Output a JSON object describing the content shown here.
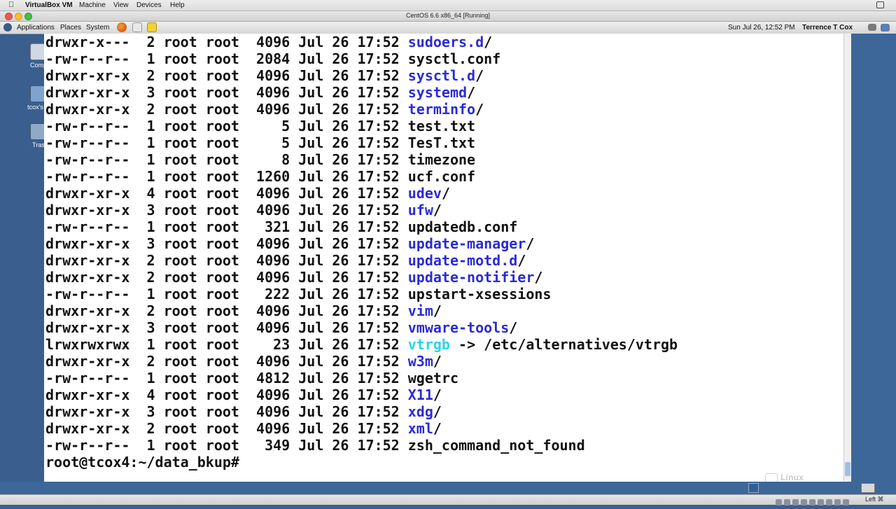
{
  "macbar": {
    "app": "VirtualBox VM",
    "menus": [
      "Machine",
      "View",
      "Devices",
      "Help"
    ]
  },
  "window": {
    "title": "CentOS 6.6 x86_64 [Running]"
  },
  "gnome_panel": {
    "menus": [
      "Applications",
      "Places",
      "System"
    ],
    "datetime": "Sun Jul 26, 12:52 PM",
    "user": "Terrence T Cox"
  },
  "desktop_icons": [
    {
      "label": "Comp",
      "icon": "computer-icon"
    },
    {
      "label": "tcox's H",
      "icon": "home-folder-icon"
    },
    {
      "label": "Tras",
      "icon": "trash-icon"
    }
  ],
  "terminal": {
    "entries": [
      {
        "perm": "drwxr-x---",
        "links": "2",
        "owner": "root",
        "group": "root",
        "size": "4096",
        "month": "Jul",
        "day": "26",
        "time": "17:52",
        "name": "sudoers.d",
        "suffix": "/",
        "type": "dir"
      },
      {
        "perm": "-rw-r--r--",
        "links": "1",
        "owner": "root",
        "group": "root",
        "size": "2084",
        "month": "Jul",
        "day": "26",
        "time": "17:52",
        "name": "sysctl.conf",
        "suffix": "",
        "type": "file"
      },
      {
        "perm": "drwxr-xr-x",
        "links": "2",
        "owner": "root",
        "group": "root",
        "size": "4096",
        "month": "Jul",
        "day": "26",
        "time": "17:52",
        "name": "sysctl.d",
        "suffix": "/",
        "type": "dir"
      },
      {
        "perm": "drwxr-xr-x",
        "links": "3",
        "owner": "root",
        "group": "root",
        "size": "4096",
        "month": "Jul",
        "day": "26",
        "time": "17:52",
        "name": "systemd",
        "suffix": "/",
        "type": "dir"
      },
      {
        "perm": "drwxr-xr-x",
        "links": "2",
        "owner": "root",
        "group": "root",
        "size": "4096",
        "month": "Jul",
        "day": "26",
        "time": "17:52",
        "name": "terminfo",
        "suffix": "/",
        "type": "dir"
      },
      {
        "perm": "-rw-r--r--",
        "links": "1",
        "owner": "root",
        "group": "root",
        "size": "5",
        "month": "Jul",
        "day": "26",
        "time": "17:52",
        "name": "test.txt",
        "suffix": "",
        "type": "file"
      },
      {
        "perm": "-rw-r--r--",
        "links": "1",
        "owner": "root",
        "group": "root",
        "size": "5",
        "month": "Jul",
        "day": "26",
        "time": "17:52",
        "name": "TesT.txt",
        "suffix": "",
        "type": "file"
      },
      {
        "perm": "-rw-r--r--",
        "links": "1",
        "owner": "root",
        "group": "root",
        "size": "8",
        "month": "Jul",
        "day": "26",
        "time": "17:52",
        "name": "timezone",
        "suffix": "",
        "type": "file"
      },
      {
        "perm": "-rw-r--r--",
        "links": "1",
        "owner": "root",
        "group": "root",
        "size": "1260",
        "month": "Jul",
        "day": "26",
        "time": "17:52",
        "name": "ucf.conf",
        "suffix": "",
        "type": "file"
      },
      {
        "perm": "drwxr-xr-x",
        "links": "4",
        "owner": "root",
        "group": "root",
        "size": "4096",
        "month": "Jul",
        "day": "26",
        "time": "17:52",
        "name": "udev",
        "suffix": "/",
        "type": "dir"
      },
      {
        "perm": "drwxr-xr-x",
        "links": "3",
        "owner": "root",
        "group": "root",
        "size": "4096",
        "month": "Jul",
        "day": "26",
        "time": "17:52",
        "name": "ufw",
        "suffix": "/",
        "type": "dir"
      },
      {
        "perm": "-rw-r--r--",
        "links": "1",
        "owner": "root",
        "group": "root",
        "size": "321",
        "month": "Jul",
        "day": "26",
        "time": "17:52",
        "name": "updatedb.conf",
        "suffix": "",
        "type": "file"
      },
      {
        "perm": "drwxr-xr-x",
        "links": "3",
        "owner": "root",
        "group": "root",
        "size": "4096",
        "month": "Jul",
        "day": "26",
        "time": "17:52",
        "name": "update-manager",
        "suffix": "/",
        "type": "dir"
      },
      {
        "perm": "drwxr-xr-x",
        "links": "2",
        "owner": "root",
        "group": "root",
        "size": "4096",
        "month": "Jul",
        "day": "26",
        "time": "17:52",
        "name": "update-motd.d",
        "suffix": "/",
        "type": "dir"
      },
      {
        "perm": "drwxr-xr-x",
        "links": "2",
        "owner": "root",
        "group": "root",
        "size": "4096",
        "month": "Jul",
        "day": "26",
        "time": "17:52",
        "name": "update-notifier",
        "suffix": "/",
        "type": "dir"
      },
      {
        "perm": "-rw-r--r--",
        "links": "1",
        "owner": "root",
        "group": "root",
        "size": "222",
        "month": "Jul",
        "day": "26",
        "time": "17:52",
        "name": "upstart-xsessions",
        "suffix": "",
        "type": "file"
      },
      {
        "perm": "drwxr-xr-x",
        "links": "2",
        "owner": "root",
        "group": "root",
        "size": "4096",
        "month": "Jul",
        "day": "26",
        "time": "17:52",
        "name": "vim",
        "suffix": "/",
        "type": "dir"
      },
      {
        "perm": "drwxr-xr-x",
        "links": "3",
        "owner": "root",
        "group": "root",
        "size": "4096",
        "month": "Jul",
        "day": "26",
        "time": "17:52",
        "name": "vmware-tools",
        "suffix": "/",
        "type": "dir"
      },
      {
        "perm": "lrwxrwxrwx",
        "links": "1",
        "owner": "root",
        "group": "root",
        "size": "23",
        "month": "Jul",
        "day": "26",
        "time": "17:52",
        "name": "vtrgb",
        "suffix": " -> /etc/alternatives/vtrgb",
        "type": "link"
      },
      {
        "perm": "drwxr-xr-x",
        "links": "2",
        "owner": "root",
        "group": "root",
        "size": "4096",
        "month": "Jul",
        "day": "26",
        "time": "17:52",
        "name": "w3m",
        "suffix": "/",
        "type": "dir"
      },
      {
        "perm": "-rw-r--r--",
        "links": "1",
        "owner": "root",
        "group": "root",
        "size": "4812",
        "month": "Jul",
        "day": "26",
        "time": "17:52",
        "name": "wgetrc",
        "suffix": "",
        "type": "file"
      },
      {
        "perm": "drwxr-xr-x",
        "links": "4",
        "owner": "root",
        "group": "root",
        "size": "4096",
        "month": "Jul",
        "day": "26",
        "time": "17:52",
        "name": "X11",
        "suffix": "/",
        "type": "dir"
      },
      {
        "perm": "drwxr-xr-x",
        "links": "3",
        "owner": "root",
        "group": "root",
        "size": "4096",
        "month": "Jul",
        "day": "26",
        "time": "17:52",
        "name": "xdg",
        "suffix": "/",
        "type": "dir"
      },
      {
        "perm": "drwxr-xr-x",
        "links": "2",
        "owner": "root",
        "group": "root",
        "size": "4096",
        "month": "Jul",
        "day": "26",
        "time": "17:52",
        "name": "xml",
        "suffix": "/",
        "type": "dir"
      },
      {
        "perm": "-rw-r--r--",
        "links": "1",
        "owner": "root",
        "group": "root",
        "size": "349",
        "month": "Jul",
        "day": "26",
        "time": "17:52",
        "name": "zsh_command_not_found",
        "suffix": "",
        "type": "file"
      }
    ],
    "prompt": "root@tcox4:~/data_bkup#"
  },
  "watermark": "Linux Academy",
  "statusbar": {
    "host_key": "Left ⌘"
  },
  "colors": {
    "dir": "#2b2bd6",
    "link": "#2cd4e8",
    "text": "#111111",
    "desktop": "#3d6699"
  }
}
